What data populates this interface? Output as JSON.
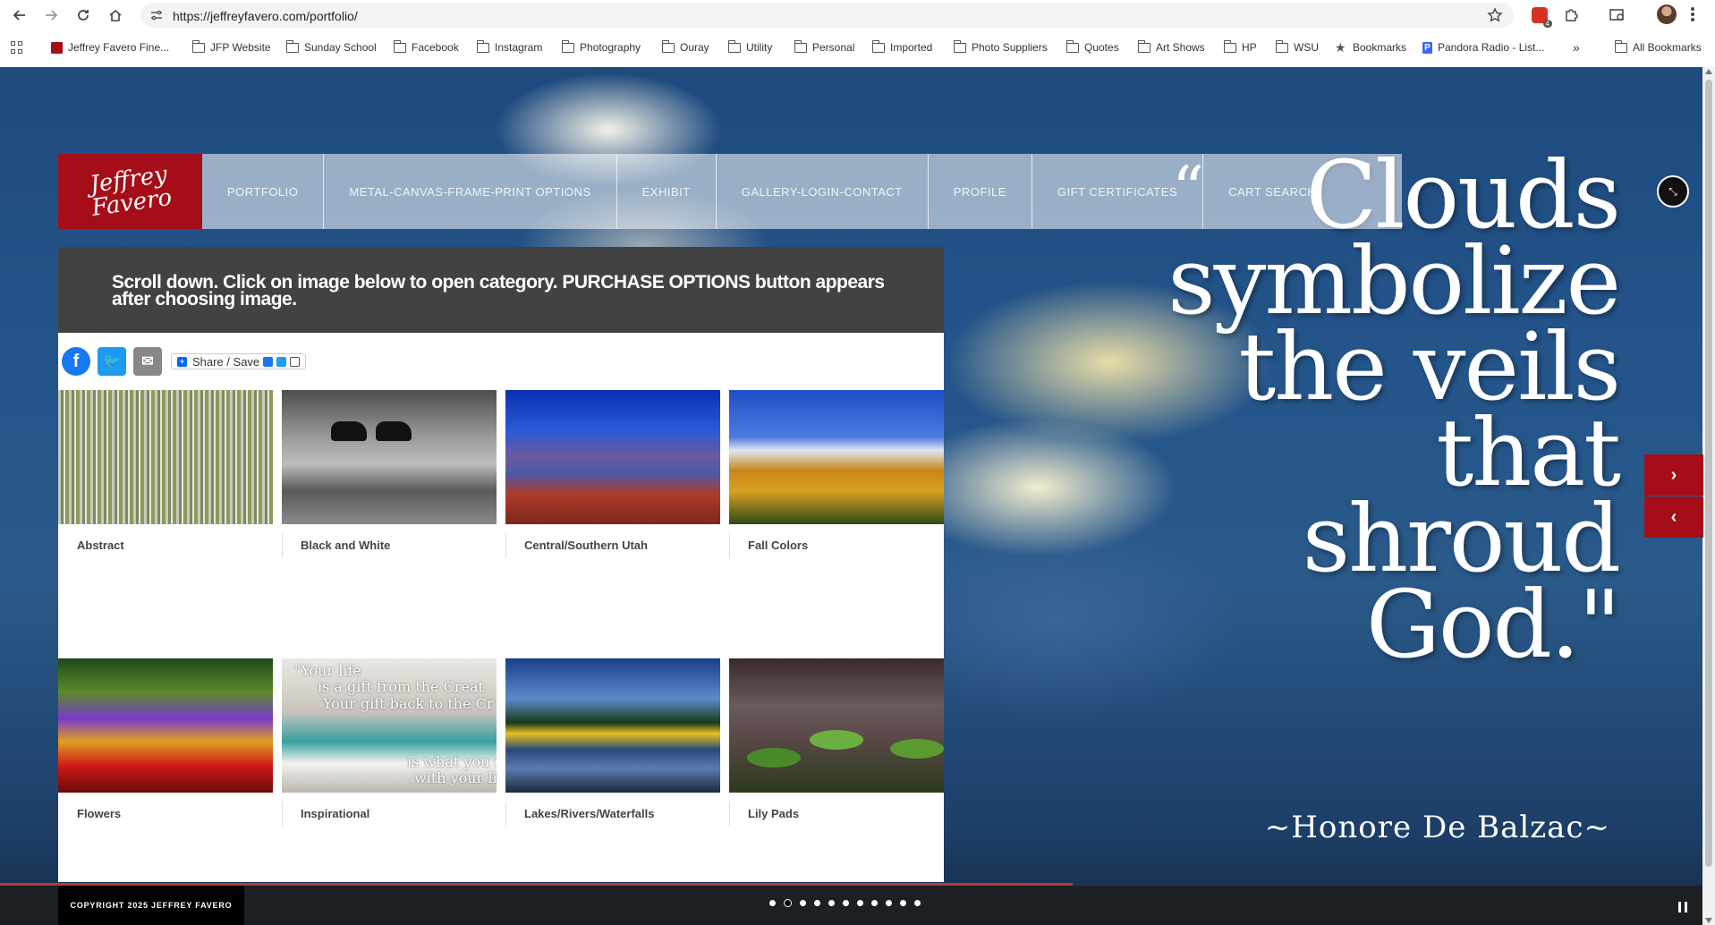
{
  "browser": {
    "url": "https://jeffreyfavero.com/portfolio/",
    "bookmarks": [
      {
        "label": "Jeffrey Favero Fine...",
        "type": "favicon"
      },
      {
        "label": "JFP Website",
        "type": "folder"
      },
      {
        "label": "Sunday School",
        "type": "folder"
      },
      {
        "label": "Facebook",
        "type": "folder"
      },
      {
        "label": "Instagram",
        "type": "folder"
      },
      {
        "label": "Photography",
        "type": "folder"
      },
      {
        "label": "Ouray",
        "type": "folder"
      },
      {
        "label": "Utility",
        "type": "folder"
      },
      {
        "label": "Personal",
        "type": "folder"
      },
      {
        "label": "Imported",
        "type": "folder"
      },
      {
        "label": "Photo Suppliers",
        "type": "folder"
      },
      {
        "label": "Quotes",
        "type": "folder"
      },
      {
        "label": "Art Shows",
        "type": "folder"
      },
      {
        "label": "HP",
        "type": "folder"
      },
      {
        "label": "WSU",
        "type": "folder"
      },
      {
        "label": "Bookmarks",
        "type": "star"
      },
      {
        "label": "Pandora Radio - List...",
        "type": "pandora"
      }
    ],
    "overflow_label": "»",
    "all_bookmarks": "All Bookmarks",
    "extension_badge": "4"
  },
  "site": {
    "logo_text": "Jeffrey Favero",
    "nav": [
      "PORTFOLIO",
      "METAL-CANVAS-FRAME-PRINT OPTIONS",
      "EXHIBIT",
      "GALLERY-LOGIN-CONTACT",
      "PROFILE",
      "GIFT CERTIFICATES",
      "CART SEARCH"
    ],
    "banner_text": "Scroll down. Click on image below to open category. PURCHASE OPTIONS button appears after choosing image.",
    "share_save": "Share / Save",
    "categories": [
      {
        "label": "Abstract",
        "thumb": "abstract"
      },
      {
        "label": "Black and White",
        "thumb": "bw"
      },
      {
        "label": "Central/Southern Utah",
        "thumb": "utah"
      },
      {
        "label": "Fall Colors",
        "thumb": "fall"
      },
      {
        "label": "Flowers",
        "thumb": "flowers"
      },
      {
        "label": "Inspirational",
        "thumb": "insp"
      },
      {
        "label": "Lakes/Rivers/Waterfalls",
        "thumb": "lakes"
      },
      {
        "label": "Lily Pads",
        "thumb": "lily"
      }
    ],
    "inspirational_thumb_text": {
      "line1": "\"Your life",
      "line2": "is a gift from the Creat",
      "line3": "Your gift back to the Cr",
      "line4": "is what you c",
      "line5": "with your lif"
    },
    "quote": {
      "open_mark": "“",
      "text_lines": [
        "Clouds",
        "symbolize",
        "the veils",
        "that",
        "shroud",
        "God.\""
      ],
      "author": "~Honore De Balzac~"
    },
    "slider": {
      "next": "›",
      "prev": "‹",
      "total_slides": 11,
      "active_slide": 2,
      "progress": 0.63
    },
    "copyright": "COPYRIGHT 2025 JEFFREY FAVERO"
  }
}
